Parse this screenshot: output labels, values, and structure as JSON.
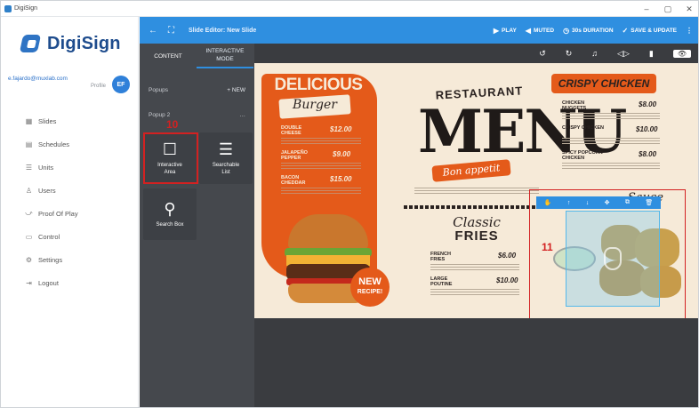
{
  "window": {
    "app_name": "DigiSign",
    "controls": [
      "–",
      "▢",
      "✕"
    ]
  },
  "sidebar": {
    "brand": "DigiSign",
    "user": {
      "email": "e.fajardo@muxlab.com",
      "profile_label": "Profile",
      "initials": "EF"
    },
    "items": [
      {
        "label": "Slides",
        "icon": "slides-icon",
        "glyph": "▦"
      },
      {
        "label": "Schedules",
        "icon": "calendar-icon",
        "glyph": "▤"
      },
      {
        "label": "Units",
        "icon": "units-icon",
        "glyph": "☰"
      },
      {
        "label": "Users",
        "icon": "users-icon",
        "glyph": "♙"
      },
      {
        "label": "Proof Of Play",
        "icon": "proof-icon",
        "glyph": "⤻"
      },
      {
        "label": "Control",
        "icon": "control-icon",
        "glyph": "▭"
      },
      {
        "label": "Settings",
        "icon": "gear-icon",
        "glyph": "⚙"
      },
      {
        "label": "Logout",
        "icon": "logout-icon",
        "glyph": "⇥"
      }
    ]
  },
  "topbar": {
    "back_glyph": "←",
    "expand_glyph": "⛶",
    "title": "Slide Editor: New Slide",
    "play": "PLAY",
    "muted": "MUTED",
    "duration": "30s DURATION",
    "save": "SAVE & UPDATE",
    "more": "⋮"
  },
  "panel": {
    "tabs": [
      "CONTENT",
      "INTERACTIVE MODE"
    ],
    "popups_label": "Popups",
    "new_label": "+ NEW",
    "popup_name": "Popup 2",
    "popup_menu": "…",
    "tools": [
      {
        "label": "Interactive Area",
        "glyph": "☐"
      },
      {
        "label": "Searchable List",
        "glyph": "☰"
      },
      {
        "label": "Search Box",
        "glyph": "⚲"
      }
    ],
    "annotation_10": "10"
  },
  "stage_toolbar": [
    "↺",
    "↻",
    "♫",
    "◁▷",
    "▮",
    "👁"
  ],
  "canvas": {
    "delicious": "DELICIOUS",
    "burger": "Burger",
    "left_items": [
      {
        "name": "DOUBLE CHEESE",
        "price": "$12.00"
      },
      {
        "name": "JALAPEÑO PEPPER",
        "price": "$9.00"
      },
      {
        "name": "BACON CHEDDAR",
        "price": "$15.00"
      }
    ],
    "restaurant": "RESTAURANT",
    "menu": "MENU",
    "bon_appetit": "Bon appetit",
    "classic": "Classic",
    "fries": "FRIES",
    "mid_items": [
      {
        "name": "FRENCH FRIES",
        "price": "$6.00"
      },
      {
        "name": "LARGE POUTINE",
        "price": "$10.00"
      }
    ],
    "new_recipe": [
      "NEW",
      "RECIPE!"
    ],
    "crispy_chicken": "CRISPY CHICKEN",
    "right_items": [
      {
        "name": "CHICKEN NUGGETS",
        "price": "$8.00"
      },
      {
        "name": "CRISPY CHICKEN",
        "price": "$10.00"
      },
      {
        "name": "SPICY POPCORN CHICKEN",
        "price": "$8.00"
      }
    ],
    "sauce": "Sauce",
    "annotation_11": "11",
    "selection_tools": [
      "✋",
      "↑",
      "↓",
      "✥",
      "⧉",
      "🗑"
    ]
  },
  "colors": {
    "accent": "#2f8fe0",
    "annotation_red": "#d32121",
    "menu_orange": "#e45a1a",
    "canvas_bg": "#f6ead8"
  }
}
